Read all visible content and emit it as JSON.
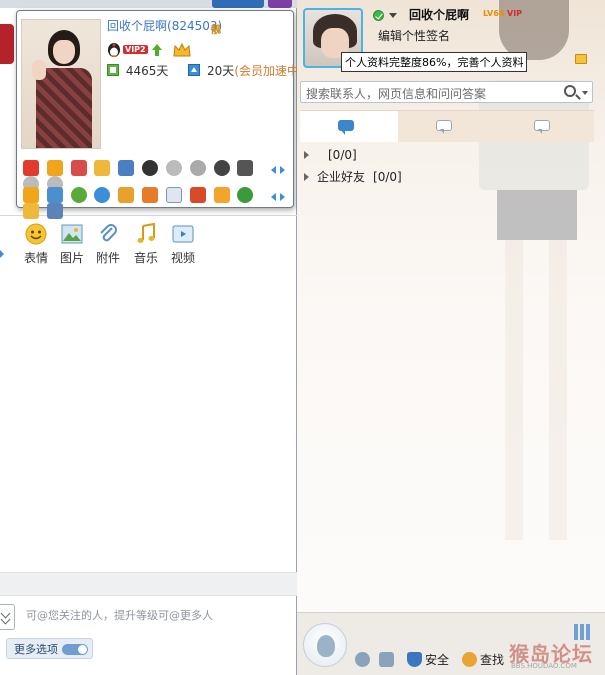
{
  "card": {
    "name": "回收个屁啊",
    "qq": "(824503)",
    "badge": "靓",
    "vip_label": "VIP2",
    "days_active": "4465天",
    "accel_days": "20天",
    "accel_label": "(会员加速中)",
    "icon_rows": [
      [
        "qq-show",
        "qzone",
        "game",
        "music",
        "pet",
        "diamond-black",
        "diamond-gray",
        "diamond-gray-2",
        "diamond-white",
        "phone",
        "diamond-gray-3",
        "diamond-gray-4"
      ],
      [
        "star",
        "camera",
        "smile",
        "search",
        "mail-vip",
        "book",
        "mail",
        "farm",
        "flag",
        "browser",
        "skin",
        "photo"
      ]
    ]
  },
  "toolbar": {
    "items": [
      {
        "label": "表情",
        "icon": "smiley-icon"
      },
      {
        "label": "图片",
        "icon": "picture-icon"
      },
      {
        "label": "附件",
        "icon": "paperclip-icon"
      },
      {
        "label": "音乐",
        "icon": "music-icon"
      },
      {
        "label": "视频",
        "icon": "video-icon"
      }
    ]
  },
  "compose": {
    "mention_hint": "可@您关注的人，提升等级可@更多人",
    "more_options": "更多选项"
  },
  "profile": {
    "nickname": "回收个屁啊",
    "level": "LV64",
    "vip": "VIP",
    "signature": "编辑个性签名",
    "tooltip": "个人资料完整度86%，完善个人资料"
  },
  "search": {
    "placeholder": "搜索联系人，网页信息和问问答案"
  },
  "contacts": {
    "groups": [
      {
        "name": "",
        "count": "[0/0]"
      },
      {
        "name": "企业好友",
        "count": "[0/0]"
      }
    ]
  },
  "bottom": {
    "security_label": "安全",
    "find_label": "查找"
  },
  "watermark": {
    "text": "猴岛论坛",
    "url": "BBS.HOUDAO.COM"
  },
  "colors": {
    "accent": "#3a8fd8",
    "link": "#3a78c3",
    "accel": "#d07a2c"
  }
}
